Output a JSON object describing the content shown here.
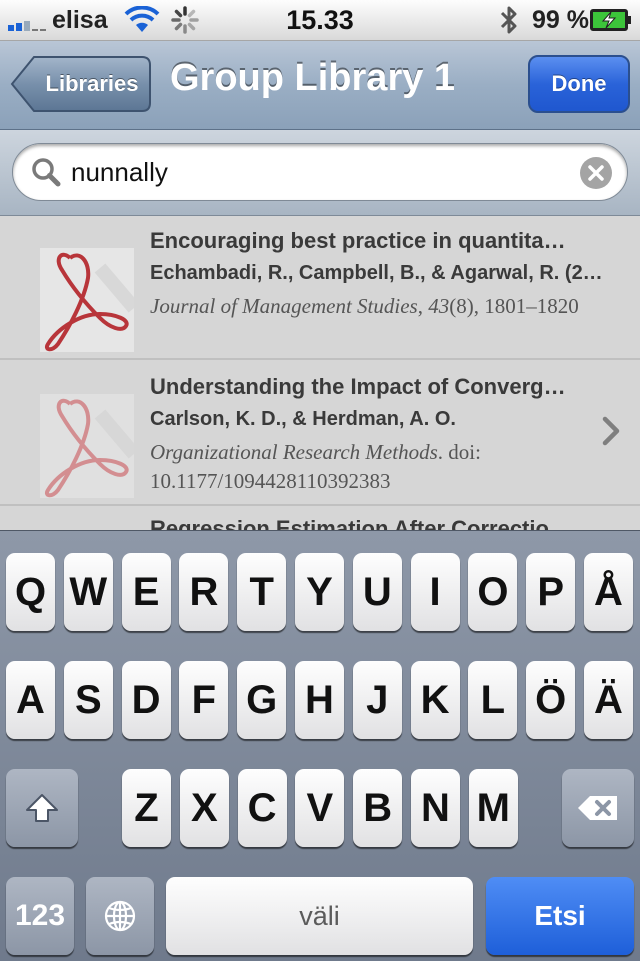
{
  "status_bar": {
    "carrier": "elisa",
    "time": "15.33",
    "battery_percent": "99 %",
    "battery_level": 0.99,
    "icons": [
      "signal-icon",
      "wifi-icon",
      "activity-spinner-icon",
      "bluetooth-icon",
      "battery-charging-icon"
    ]
  },
  "nav": {
    "back_label": "Libraries",
    "title": "Group Library 1",
    "done_label": "Done"
  },
  "search": {
    "query": "nunnally"
  },
  "results": [
    {
      "title": "Encouraging best practice in quantita…",
      "authors": "Echambadi, R., Campbell, B., & Agarwal, R. (2…",
      "journal": "Journal of Management Studies",
      "cite_rest_1": ", ",
      "volume": "43",
      "cite_rest_2": "(8), 1801–1820",
      "icon": "pdf-icon"
    },
    {
      "title": "Understanding the Impact of Converg…",
      "authors": "Carlson, K. D., & Herdman, A. O.",
      "journal": "Organizational Research Methods",
      "cite_rest_1": ". doi: 10.1177/1094428110392383",
      "icon": "pdf-icon"
    }
  ],
  "partial_row_title": "Regression Estimation After Correctio…",
  "keyboard": {
    "row1": [
      "Q",
      "W",
      "E",
      "R",
      "T",
      "Y",
      "U",
      "I",
      "O",
      "P",
      "Å"
    ],
    "row2": [
      "A",
      "S",
      "D",
      "F",
      "G",
      "H",
      "J",
      "K",
      "L",
      "Ö",
      "Ä"
    ],
    "row3": [
      "Z",
      "X",
      "C",
      "V",
      "B",
      "N",
      "M"
    ],
    "numbers_label": "123",
    "space_label": "väli",
    "return_label": "Etsi"
  },
  "colors": {
    "accent_blue": "#2a63d9",
    "pdf_red": "#b8353a"
  }
}
